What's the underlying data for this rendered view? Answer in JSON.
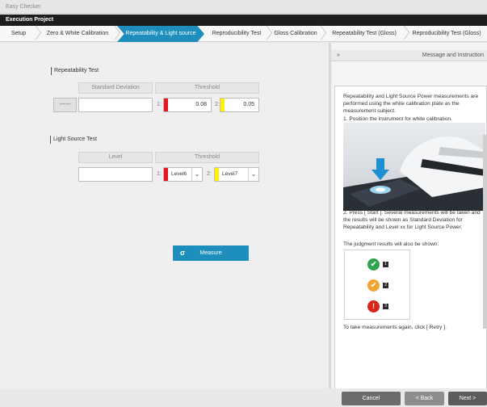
{
  "window": {
    "title": "Easy Checker"
  },
  "project_bar": {
    "title": "Execution Project"
  },
  "tabs": [
    {
      "label": "Setup",
      "active": false
    },
    {
      "label": "Zero & White Calibration",
      "active": false
    },
    {
      "label": "Repeatability & Light source",
      "active": true
    },
    {
      "label": "Reproducibility Test",
      "active": false
    },
    {
      "label": "Gloss Calibration",
      "active": false
    },
    {
      "label": "Repeatability Test (Gloss)",
      "active": false
    },
    {
      "label": "Reproducibility Test (Gloss)",
      "active": false
    }
  ],
  "repeatability": {
    "title": "Repeatability Test",
    "col_std": "Standard Deviation",
    "col_threshold": "Threshold",
    "dash_button": "------",
    "std_value": "",
    "threshold1_num": "1:",
    "threshold1_value": "0.08",
    "threshold1_color": "#e8141e",
    "threshold2_num": "2:",
    "threshold2_value": "0.05",
    "threshold2_color": "#ffef00"
  },
  "light_source": {
    "title": "Light Source Test",
    "col_level": "Level",
    "col_threshold": "Threshold",
    "level_value": "",
    "threshold1_num": "1:",
    "threshold1_value": "Level6",
    "threshold1_color": "#e8141e",
    "threshold2_num": "2:",
    "threshold2_value": "Level7",
    "threshold2_color": "#ffef00"
  },
  "measure_button": {
    "label": "Measure",
    "icon": "measure-icon"
  },
  "message_panel": {
    "collapse_label": "»",
    "title": "Message and Instruction",
    "para1": "Repeatability and Light Source Power measurements are performed using the white calibration plate as the measurement subject.",
    "step1": "1. Position the instrument for white calibration.",
    "step2": "2. Press [ Start ]. Several measurements will be taken and the results will be shown as Standard Deviation for Repeatability and Level xx for Light Source Power.",
    "judgment_intro": "The judgment results will also be shown:",
    "judgment": [
      {
        "icon": "check-icon",
        "glyph": "✔",
        "color": "#2ea44f",
        "number": "1"
      },
      {
        "icon": "check-icon",
        "glyph": "✔",
        "color": "#f2a531",
        "number": "2"
      },
      {
        "icon": "exclamation-icon",
        "glyph": "!",
        "color": "#d9231b",
        "number": "3"
      }
    ],
    "retry_text": "To take measurements again, click [ Retry ]."
  },
  "footer": {
    "cancel": "Cancel",
    "back": "< Back",
    "next": "Next >"
  }
}
